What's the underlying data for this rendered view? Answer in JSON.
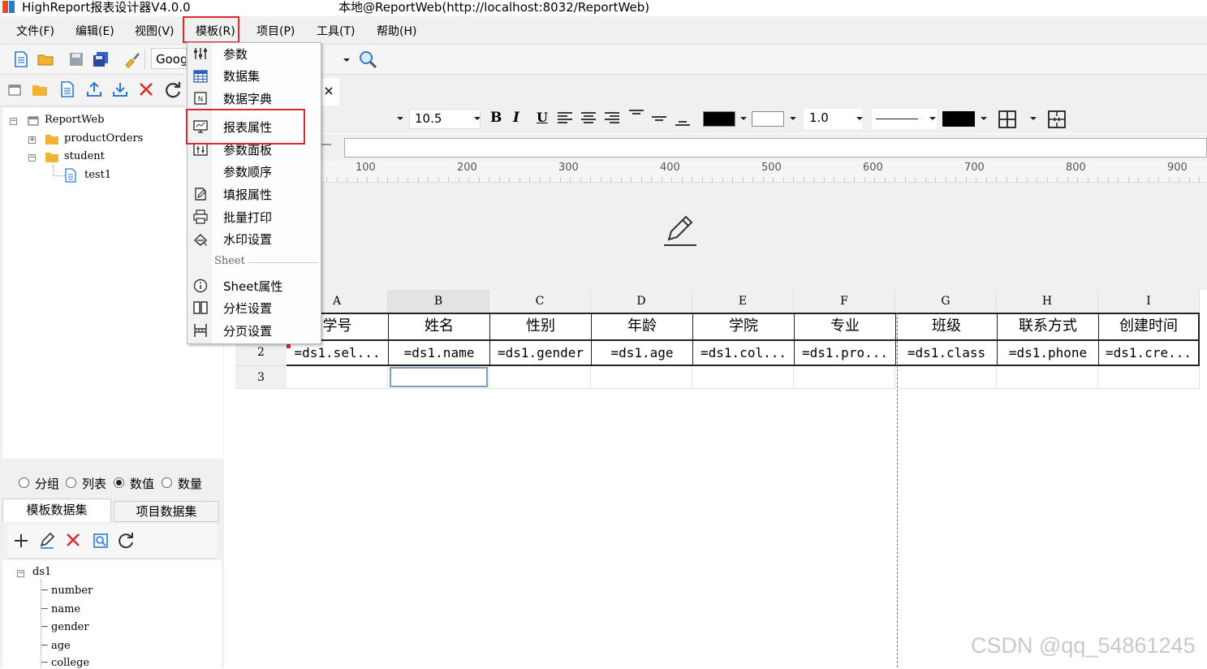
{
  "window": {
    "app_title": "HighReport报表设计器V4.0.0",
    "connection_title": "本地@ReportWeb(http://localhost:8032/ReportWeb)"
  },
  "menubar": {
    "items": [
      {
        "label": "文件(F)"
      },
      {
        "label": "编辑(E)"
      },
      {
        "label": "视图(V)"
      },
      {
        "label": "模板(R)"
      },
      {
        "label": "项目(P)"
      },
      {
        "label": "工具(T)"
      },
      {
        "label": "帮助(H)"
      }
    ]
  },
  "toolbar1": {
    "font_name": "Goog"
  },
  "format_toolbar": {
    "font_size": "10.5",
    "border_width": "1.0",
    "font_color": "#000000",
    "fill_color": "#ffffff",
    "border_color": "#000000"
  },
  "project_tree": {
    "root": "ReportWeb",
    "children": [
      {
        "label": "productOrders"
      },
      {
        "label": "student",
        "children": [
          {
            "label": "test1"
          }
        ]
      }
    ]
  },
  "dataset_mode": {
    "options": [
      {
        "label": "分组",
        "selected": false
      },
      {
        "label": "列表",
        "selected": false
      },
      {
        "label": "数值",
        "selected": true
      },
      {
        "label": "数量",
        "selected": false
      }
    ]
  },
  "dataset_tabs": {
    "template": "模板数据集",
    "project": "项目数据集"
  },
  "dataset_tree": {
    "root": "ds1",
    "fields": [
      "number",
      "name",
      "gender",
      "age",
      "college"
    ]
  },
  "ruler": {
    "marks": [
      "100",
      "200",
      "300",
      "400",
      "500",
      "600",
      "700",
      "800",
      "900"
    ]
  },
  "grid": {
    "columns": [
      "A",
      "B",
      "C",
      "D",
      "E",
      "F",
      "G",
      "H",
      "I"
    ],
    "rows": [
      "2",
      "3"
    ],
    "header_row": [
      "学号",
      "姓名",
      "性别",
      "年龄",
      "学院",
      "专业",
      "班级",
      "联系方式",
      "创建时间"
    ],
    "data_row": [
      "=ds1.sel...",
      "=ds1.name",
      "=ds1.gender",
      "=ds1.age",
      "=ds1.col...",
      "=ds1.pro...",
      "=ds1.class",
      "=ds1.phone",
      "=ds1.cre..."
    ]
  },
  "template_menu": {
    "items": [
      {
        "label": "参数",
        "icon": "sliders-icon"
      },
      {
        "label": "数据集",
        "icon": "table-icon"
      },
      {
        "label": "数据字典",
        "icon": "dictionary-icon"
      },
      {
        "label": "报表属性",
        "icon": "report-properties-icon"
      },
      {
        "label": "参数面板",
        "icon": "parameter-panel-icon"
      },
      {
        "label": "参数顺序",
        "icon": ""
      },
      {
        "label": "填报属性",
        "icon": "edit-form-icon"
      },
      {
        "label": "批量打印",
        "icon": "printer-icon"
      },
      {
        "label": "水印设置",
        "icon": "watermark-icon"
      }
    ],
    "section_label": "Sheet",
    "sheet_items": [
      {
        "label": "Sheet属性",
        "icon": "info-icon"
      },
      {
        "label": "分栏设置",
        "icon": "columns-icon"
      },
      {
        "label": "分页设置",
        "icon": "page-break-icon"
      }
    ]
  },
  "watermark": "CSDN @qq_54861245"
}
